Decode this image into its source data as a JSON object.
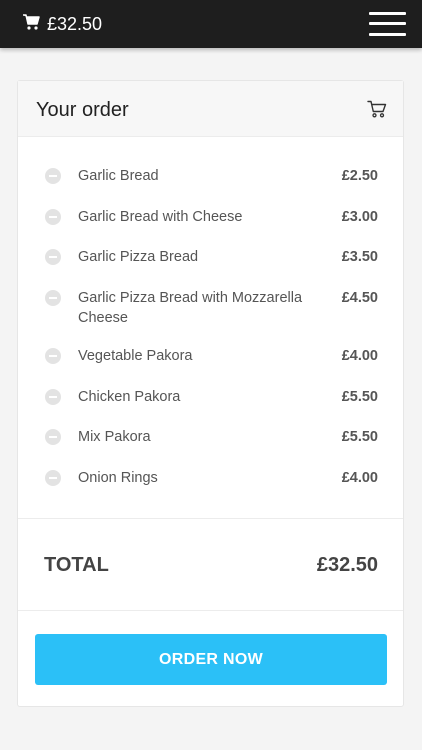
{
  "topbar": {
    "cart_total": "£32.50",
    "cart_icon": "cart-icon",
    "menu_icon": "hamburger-menu-icon"
  },
  "order": {
    "title": "Your order",
    "header_icon": "cart-outline-icon",
    "items": [
      {
        "name": "Garlic Bread",
        "price": "£2.50"
      },
      {
        "name": "Garlic Bread with Cheese",
        "price": "£3.00"
      },
      {
        "name": "Garlic Pizza Bread",
        "price": "£3.50"
      },
      {
        "name": "Garlic Pizza Bread with Mozzarella Cheese",
        "price": "£4.50"
      },
      {
        "name": "Vegetable Pakora",
        "price": "£4.00"
      },
      {
        "name": "Chicken Pakora",
        "price": "£5.50"
      },
      {
        "name": "Mix Pakora",
        "price": "£5.50"
      },
      {
        "name": "Onion Rings",
        "price": "£4.00"
      }
    ],
    "total_label": "TOTAL",
    "total_value": "£32.50",
    "order_button": "ORDER NOW"
  },
  "colors": {
    "topbar": "#1e1e1e",
    "accent": "#2bc0f7",
    "background": "#f4f4f4"
  }
}
